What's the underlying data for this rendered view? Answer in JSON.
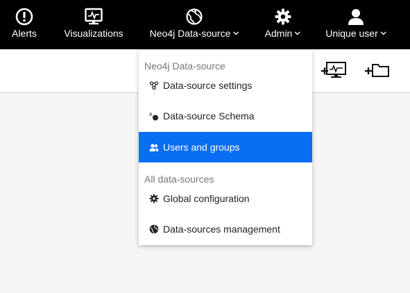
{
  "nav": {
    "alerts": "Alerts",
    "visualizations": "Visualizations",
    "datasource": "Neo4j Data-source",
    "admin": "Admin",
    "user": "Unique user"
  },
  "dropdown": {
    "section1_header": "Neo4j Data-source",
    "item_settings": "Data-source settings",
    "item_schema": "Data-source Schema",
    "item_users": "Users and groups",
    "section2_header": "All data-sources",
    "item_global": "Global configuration",
    "item_management": "Data-sources management"
  },
  "colors": {
    "nav_bg": "#000000",
    "active_item": "#0a6ef5",
    "page_bg": "#f4f5f4"
  },
  "icons": {
    "alerts": "exclamation-circle-icon",
    "visualizations": "monitor-pulse-icon",
    "datasource": "globe-icon",
    "admin": "gear-icon",
    "user": "user-icon",
    "new_visualization": "add-monitor-icon",
    "new_folder": "add-folder-icon"
  }
}
